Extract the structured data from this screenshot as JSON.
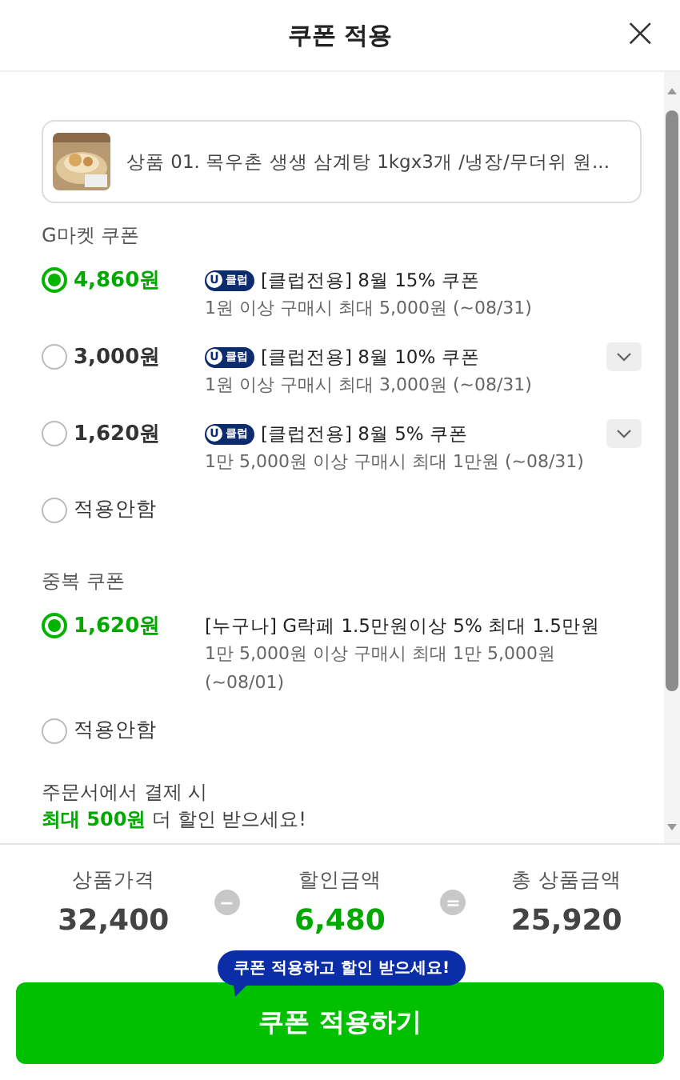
{
  "header": {
    "title": "쿠폰 적용",
    "close": "×"
  },
  "product": {
    "name": "상품 01. 목우촌 생생 삼계탕 1kgx3개 /냉장/무더위 원..."
  },
  "sections": [
    {
      "title": "G마켓 쿠폰",
      "options": [
        {
          "kind": "coupon",
          "selected": true,
          "amount": "4,860원",
          "badge": {
            "mark": "U",
            "label": "클럽"
          },
          "name": "[클럽전용] 8월 15% 쿠폰",
          "desc": "1원 이상 구매시 최대 5,000원 (~08/31)",
          "expandable": false
        },
        {
          "kind": "coupon",
          "selected": false,
          "amount": "3,000원",
          "badge": {
            "mark": "U",
            "label": "클럽"
          },
          "name": "[클럽전용] 8월 10% 쿠폰",
          "desc": "1원 이상 구매시 최대 3,000원 (~08/31)",
          "expandable": true
        },
        {
          "kind": "coupon",
          "selected": false,
          "amount": "1,620원",
          "badge": {
            "mark": "U",
            "label": "클럽"
          },
          "name": "[클럽전용] 8월 5% 쿠폰",
          "desc": "1만 5,000원 이상 구매시 최대 1만원 (~08/31)",
          "expandable": true
        },
        {
          "kind": "none",
          "selected": false,
          "label": "적용안함"
        }
      ]
    },
    {
      "title": "중복 쿠폰",
      "options": [
        {
          "kind": "coupon",
          "selected": true,
          "amount": "1,620원",
          "name": "[누구나] G락페 1.5만원이상 5% 최대 1.5만원",
          "desc": "1만 5,000원 이상 구매시 최대 1만 5,000원 (~08/01)",
          "expandable": false
        },
        {
          "kind": "none",
          "selected": false,
          "label": "적용안함"
        }
      ]
    }
  ],
  "notice": {
    "line1": "주문서에서 결제 시",
    "line2": "**최대 500원** 더 할인 받으세요!"
  },
  "summary": [
    {
      "kind": "value",
      "label": "상품가격",
      "value": "32,400"
    },
    {
      "kind": "op",
      "op": "−"
    },
    {
      "kind": "discount",
      "label": "할인금액",
      "value": "6,480"
    },
    {
      "kind": "op",
      "op": "="
    },
    {
      "kind": "value",
      "label": "총 상품금액",
      "value": "25,920"
    }
  ],
  "tooltip": "쿠폰 적용하고 할인 받으세요!",
  "apply_button": "쿠폰 적용하기"
}
